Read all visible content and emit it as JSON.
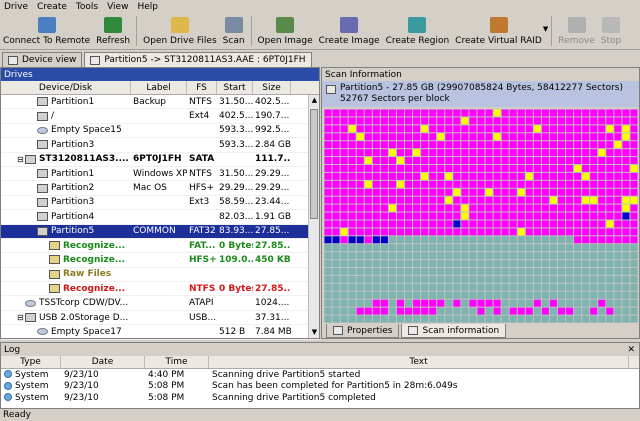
{
  "menu": [
    "Drive",
    "Create",
    "Tools",
    "View",
    "Help"
  ],
  "toolbar": {
    "buttons": [
      {
        "label": "Connect To Remote",
        "icon": "network-computer-icon",
        "color": "#4a7fc2",
        "enabled": true
      },
      {
        "label": "Refresh",
        "icon": "refresh-icon",
        "color": "#2f8a3a",
        "enabled": true
      },
      {
        "label": "Open Drive Files",
        "icon": "open-folder-icon",
        "color": "#e0b84a",
        "enabled": true
      },
      {
        "label": "Scan",
        "icon": "scan-icon",
        "color": "#7a8aa0",
        "enabled": true
      },
      {
        "label": "Open Image",
        "icon": "open-image-icon",
        "color": "#5a8a4a",
        "enabled": true
      },
      {
        "label": "Create Image",
        "icon": "create-image-icon",
        "color": "#6a6ab0",
        "enabled": true
      },
      {
        "label": "Create Region",
        "icon": "create-region-icon",
        "color": "#3a9aa0",
        "enabled": true
      },
      {
        "label": "Create Virtual RAID",
        "icon": "raid-icon",
        "color": "#c07a30",
        "enabled": true
      },
      {
        "label": "Remove",
        "icon": "remove-icon",
        "color": "#b0b0b0",
        "enabled": false
      },
      {
        "label": "Stop",
        "icon": "stop-icon",
        "color": "#b8b8b8",
        "enabled": false
      }
    ]
  },
  "tabs": [
    {
      "label": "Device view"
    },
    {
      "label": "Partition5 -> ST3120811AS3.AAE : 6PT0J1FH"
    }
  ],
  "drives": {
    "title": "Drives",
    "columns": [
      "Device/Disk",
      "Label",
      "FS",
      "Start",
      "Size"
    ],
    "rows": [
      {
        "name": "Partition1",
        "label": "Backup",
        "fs": "NTFS",
        "start": "31.50...",
        "size": "402.5...",
        "kind": "drive",
        "indent": 2,
        "style": ""
      },
      {
        "name": "/",
        "label": "",
        "fs": "Ext4",
        "start": "402.5...",
        "size": "190.7...",
        "kind": "drive",
        "indent": 2,
        "style": ""
      },
      {
        "name": "Empty Space15",
        "label": "",
        "fs": "",
        "start": "593.3...",
        "size": "992.5...",
        "kind": "space",
        "indent": 2,
        "style": ""
      },
      {
        "name": "Partition3",
        "label": "",
        "fs": "",
        "start": "593.3...",
        "size": "2.84 GB",
        "kind": "drive",
        "indent": 2,
        "style": ""
      },
      {
        "name": "ST3120811AS3....",
        "label": "6PT0J1FH",
        "fs": "SATA",
        "start": "",
        "size": "111.7...",
        "kind": "disk",
        "indent": 1,
        "style": "bold"
      },
      {
        "name": "Partition1",
        "label": "Windows XP",
        "fs": "NTFS",
        "start": "31.50...",
        "size": "29.29...",
        "kind": "drive",
        "indent": 2,
        "style": ""
      },
      {
        "name": "Partition2",
        "label": "Mac OS",
        "fs": "HFS+",
        "start": "29.29...",
        "size": "29.29...",
        "kind": "drive",
        "indent": 2,
        "style": ""
      },
      {
        "name": "Partition3",
        "label": "",
        "fs": "Ext3",
        "start": "58.59...",
        "size": "23.44...",
        "kind": "drive",
        "indent": 2,
        "style": ""
      },
      {
        "name": "Partition4",
        "label": "",
        "fs": "",
        "start": "82.03...",
        "size": "1.91 GB",
        "kind": "drive",
        "indent": 2,
        "style": ""
      },
      {
        "name": "Partition5",
        "label": "COMMON",
        "fs": "FAT32",
        "start": "83.93...",
        "size": "27.85...",
        "kind": "drive",
        "indent": 2,
        "style": "selected"
      },
      {
        "name": "Recognize...",
        "label": "",
        "fs": "FAT...",
        "start": "0 Bytes",
        "size": "27.85...",
        "kind": "recog",
        "indent": 3,
        "style": "green"
      },
      {
        "name": "Recognize...",
        "label": "",
        "fs": "HFS+",
        "start": "109.0...",
        "size": "450 KB",
        "kind": "recog",
        "indent": 3,
        "style": "green"
      },
      {
        "name": "Raw Files",
        "label": "",
        "fs": "",
        "start": "",
        "size": "",
        "kind": "recog",
        "indent": 3,
        "style": "olive"
      },
      {
        "name": "Recognize...",
        "label": "",
        "fs": "NTFS",
        "start": "0 Bytes",
        "size": "27.85...",
        "kind": "recog",
        "indent": 3,
        "style": "red"
      },
      {
        "name": "TSSTcorp CDW/DV...",
        "label": "",
        "fs": "ATAPI",
        "start": "",
        "size": "1024....",
        "kind": "cd",
        "indent": 1,
        "style": ""
      },
      {
        "name": "USB 2.0Storage D...",
        "label": "",
        "fs": "USB...",
        "start": "",
        "size": "37.31...",
        "kind": "disk",
        "indent": 1,
        "style": ""
      },
      {
        "name": "Empty Space17",
        "label": "",
        "fs": "",
        "start": "512 B",
        "size": "7.84 MB",
        "kind": "space",
        "indent": 2,
        "style": ""
      }
    ]
  },
  "scan": {
    "title": "Scan Information",
    "line1": "Partition5 - 27.85 GB (29907085824 Bytes, 58412277 Sectors)",
    "line2": "52767 Sectors per block",
    "tabs": [
      "Properties",
      "Scan information"
    ],
    "colors": {
      "used": "#ff00ff",
      "free": "#7fb3b0",
      "blue": "#0000cc",
      "yellow": "#ffff00",
      "grid": "#c0c0c0"
    }
  },
  "log": {
    "title": "Log",
    "columns": [
      "Type",
      "Date",
      "Time",
      "Text"
    ],
    "rows": [
      {
        "type": "System",
        "date": "9/23/10",
        "time": "4:40 PM",
        "text": "Scanning drive Partition5 started"
      },
      {
        "type": "System",
        "date": "9/23/10",
        "time": "5:08 PM",
        "text": "Scan has been completed for Partition5 in 28m:6.049s"
      },
      {
        "type": "System",
        "date": "9/23/10",
        "time": "5:08 PM",
        "text": "Scanning drive Partition5 completed"
      }
    ]
  },
  "status": "Ready"
}
